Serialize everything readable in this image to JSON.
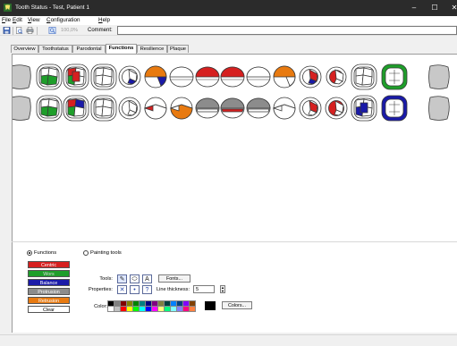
{
  "window": {
    "title": "Tooth Status - Test, Patient 1",
    "minimize_glyph": "–",
    "maximize_glyph": "☐",
    "close_glyph": "✕",
    "app_icon": "tooth-app-icon"
  },
  "menu": [
    {
      "underline": "F",
      "rest": "ile"
    },
    {
      "underline": "E",
      "rest": "dit"
    },
    {
      "underline": "V",
      "rest": "iew"
    },
    {
      "underline": "C",
      "rest": "onfiguration"
    },
    {
      "underline": "H",
      "rest": "elp"
    }
  ],
  "toolbar": {
    "icons": [
      "save-icon",
      "print-preview-icon",
      "print-icon",
      "zoom-icon"
    ],
    "zoom_value": "100,0%",
    "comment_label": "Comment:",
    "comment_value": ""
  },
  "tabs": [
    {
      "label": "Overview",
      "active": false
    },
    {
      "label": "Toothstatus",
      "active": false
    },
    {
      "label": "Parodontal",
      "active": false
    },
    {
      "label": "Functions",
      "active": true
    },
    {
      "label": "Resilience",
      "active": false
    },
    {
      "label": "Plaque",
      "active": false
    }
  ],
  "colors": {
    "titlebar": "#2b2b2b",
    "centric": "#d62020",
    "green": "#1e9e2a",
    "balance": "#1a1aa8",
    "protrusion": "#8c8c8c",
    "retrusion": "#e87a10",
    "tooth_outline": "#3a3a3a",
    "tooth_fill": "#ffffff",
    "tooth_missing": "#c8c8c8",
    "current_color": "#000000"
  },
  "teeth": {
    "upper": [
      {
        "kind": "missing"
      },
      {
        "kind": "molar",
        "fills": [
          "",
          "#1e9e2a",
          "",
          "#1e9e2a",
          ""
        ]
      },
      {
        "kind": "molar",
        "fills": [
          "#d62020",
          "#1e9e2a",
          "",
          "",
          "#d62020"
        ]
      },
      {
        "kind": "molar",
        "fills": [
          "",
          "",
          "",
          "",
          ""
        ]
      },
      {
        "kind": "premolar",
        "fills": [
          "",
          "",
          "#1a1aa8"
        ]
      },
      {
        "kind": "canine",
        "fills": [
          "#e87a10",
          "",
          "#1a1aa8"
        ]
      },
      {
        "kind": "incisor",
        "fills": [
          "",
          ""
        ]
      },
      {
        "kind": "incisor",
        "fills": [
          "#d62020",
          ""
        ]
      },
      {
        "kind": "incisor",
        "fills": [
          "#d62020",
          ""
        ]
      },
      {
        "kind": "incisor",
        "fills": [
          "",
          ""
        ]
      },
      {
        "kind": "canine",
        "fills": [
          "#e87a10",
          "",
          ""
        ]
      },
      {
        "kind": "premolar",
        "fills": [
          "",
          "#d62020",
          "#1a1aa8"
        ]
      },
      {
        "kind": "premolar-small",
        "fills": [
          "#d62020",
          "",
          ""
        ]
      },
      {
        "kind": "molar",
        "fills": [
          "",
          "",
          "",
          "",
          ""
        ]
      },
      {
        "kind": "molar-ring",
        "ring": "#1e9e2a",
        "fills": [
          "",
          "",
          "",
          "",
          ""
        ]
      },
      {
        "kind": "missing"
      }
    ],
    "lower": [
      {
        "kind": "missing"
      },
      {
        "kind": "molar",
        "fills": [
          "",
          "#1e9e2a",
          "",
          "#1e9e2a",
          ""
        ]
      },
      {
        "kind": "molar",
        "fills": [
          "#d62020",
          "#1e9e2a",
          "#1a1aa8",
          "",
          ""
        ]
      },
      {
        "kind": "molar",
        "fills": [
          "",
          "",
          "",
          "",
          ""
        ]
      },
      {
        "kind": "premolar",
        "fills": [
          "",
          "",
          ""
        ]
      },
      {
        "kind": "canine-low",
        "fills": [
          "",
          "#d62020",
          ""
        ]
      },
      {
        "kind": "canine-low",
        "fills": [
          "#e87a10",
          "",
          ""
        ]
      },
      {
        "kind": "incisor-low",
        "fills": [
          "#8c8c8c",
          ""
        ]
      },
      {
        "kind": "incisor-low",
        "fills": [
          "#8c8c8c",
          "#d62020"
        ]
      },
      {
        "kind": "incisor-low",
        "fills": [
          "#8c8c8c",
          ""
        ]
      },
      {
        "kind": "canine-low",
        "fills": [
          "",
          "",
          ""
        ]
      },
      {
        "kind": "premolar",
        "fills": [
          "",
          "#d62020",
          ""
        ]
      },
      {
        "kind": "premolar",
        "fills": [
          "#d62020",
          "",
          ""
        ]
      },
      {
        "kind": "molar",
        "fills": [
          "",
          "#1a1aa8",
          "",
          "",
          "#1a1aa8"
        ]
      },
      {
        "kind": "molar-ring",
        "ring": "#1a1aa8",
        "fills": [
          "",
          "",
          "",
          "",
          ""
        ]
      },
      {
        "kind": "missing"
      }
    ]
  },
  "functions": {
    "label": "Functions",
    "selected": true,
    "buttons": [
      {
        "label": "Centric",
        "color": "#d62020",
        "dim": false
      },
      {
        "label": "Wors",
        "color": "#1e9e2a",
        "dim": true
      },
      {
        "label": "Balance",
        "color": "#1a1aa8",
        "dim": false
      },
      {
        "label": "Protrusion",
        "color": "#8c8c8c",
        "dim": false
      },
      {
        "label": "Retrusion",
        "color": "#e87a10",
        "dim": false
      },
      {
        "label": "Clear",
        "color": "#ffffff",
        "dim": false
      }
    ]
  },
  "painting": {
    "label": "Painting tools",
    "selected": false,
    "tools_label": "Tools:",
    "tools": [
      {
        "glyph": "✎",
        "name": "pencil-tool-icon"
      },
      {
        "glyph": "⬭",
        "name": "eraser-tool-icon"
      },
      {
        "glyph": "A",
        "name": "text-tool-icon"
      }
    ],
    "fonts_label": "Fonts...",
    "properties_label": "Properties:",
    "properties": [
      {
        "glyph": "✕",
        "name": "cross-property-icon"
      },
      {
        "glyph": "•",
        "name": "dot-property-icon"
      },
      {
        "glyph": "?",
        "name": "question-property-icon"
      }
    ],
    "line_thickness_label": "Line thickness:",
    "line_thickness_value": "5",
    "color_label": "Color:",
    "colors_button": "Colors...",
    "palette": [
      "#000000",
      "#808080",
      "#800000",
      "#808000",
      "#008000",
      "#008080",
      "#000080",
      "#800080",
      "#808040",
      "#004040",
      "#0080ff",
      "#004080",
      "#8000ff",
      "#804000",
      "#ffffff",
      "#c0c0c0",
      "#ff0000",
      "#ffff00",
      "#00ff00",
      "#00ffff",
      "#0000ff",
      "#ff00ff",
      "#ffff80",
      "#00ff80",
      "#80ffff",
      "#8080ff",
      "#ff0080",
      "#ff8040"
    ]
  }
}
